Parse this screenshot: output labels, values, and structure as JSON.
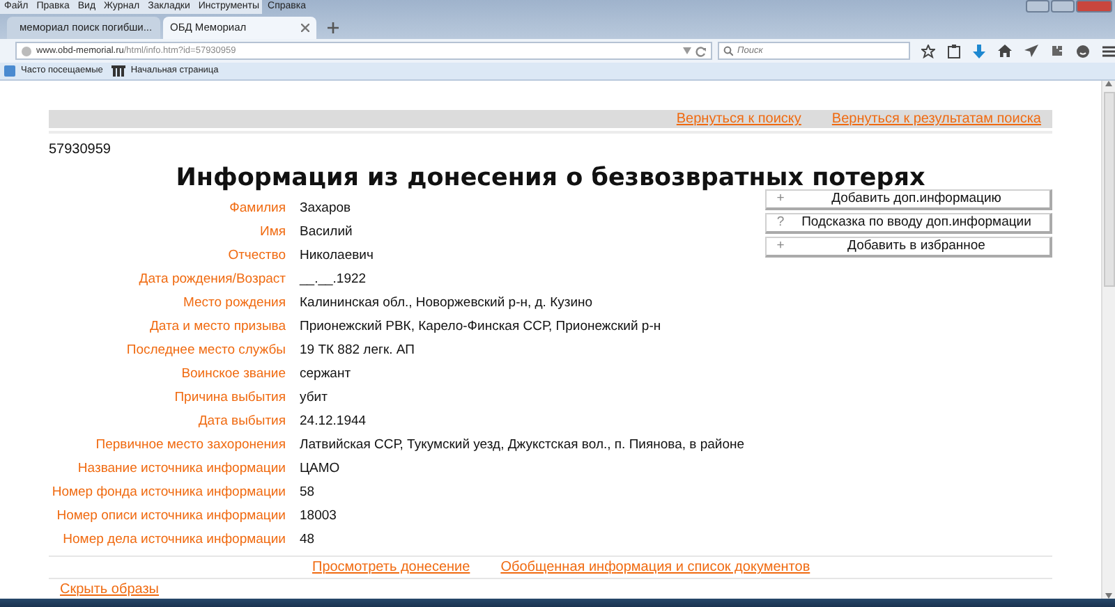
{
  "menu_bar": [
    "Файл",
    "Правка",
    "Вид",
    "Журнал",
    "Закладки",
    "Инструменты",
    "Справка"
  ],
  "tabs": [
    {
      "title": "мемориал поиск погибши...",
      "selected": false
    },
    {
      "title": "ОБД Мемориал",
      "selected": true
    }
  ],
  "address_bar": {
    "url": "**www.obd-memorial.ru**/html/info.htm?id=57930959"
  },
  "search": {
    "placeholder": "Поиск"
  },
  "bookmarks": [
    "Часто посещаемые",
    "Начальная страница"
  ],
  "page": {
    "top_links": [
      "Вернуться к поиску",
      "Вернуться к результатам поиска"
    ],
    "record_id": "57930959",
    "heading": "Информация из донесения о безвозвратных потерях",
    "fields": [
      {
        "label": "Фамилия",
        "value": "Захаров"
      },
      {
        "label": "Имя",
        "value": "Василий"
      },
      {
        "label": "Отчество",
        "value": "Николаевич"
      },
      {
        "label": "Дата рождения/Возраст",
        "value": "__.__.1922"
      },
      {
        "label": "Место рождения",
        "value": "Калининская обл., Новоржевский р-н, д. Кузино"
      },
      {
        "label": "Дата и место призыва",
        "value": "Прионежский РВК, Карело-Финская ССР, Прионежский р-н"
      },
      {
        "label": "Последнее место службы",
        "value": "19 ТК 882 легк. АП"
      },
      {
        "label": "Воинское звание",
        "value": "сержант"
      },
      {
        "label": "Причина выбытия",
        "value": "убит"
      },
      {
        "label": "Дата выбытия",
        "value": "24.12.1944"
      },
      {
        "label": "Первичное место захоронения",
        "value": "Латвийская ССР, Тукумский уезд, Джукстская вол., п. Пиянова, в районе"
      },
      {
        "label": "Название источника информации",
        "value": "ЦАМО"
      },
      {
        "label": "Номер фонда источника информации",
        "value": "58"
      },
      {
        "label": "Номер описи источника информации",
        "value": "18003"
      },
      {
        "label": "Номер дела источника информации",
        "value": "48"
      }
    ],
    "actions": [
      {
        "icon": "+",
        "label": "Добавить доп.информацию"
      },
      {
        "icon": "?",
        "label": "Подсказка по вводу доп.информации"
      },
      {
        "icon": "+",
        "label": "Добавить в избранное"
      }
    ],
    "bottom_links": [
      "Просмотреть донесение",
      "Обобщенная информация и список документов"
    ],
    "hide_images_link": "Скрыть образы"
  }
}
